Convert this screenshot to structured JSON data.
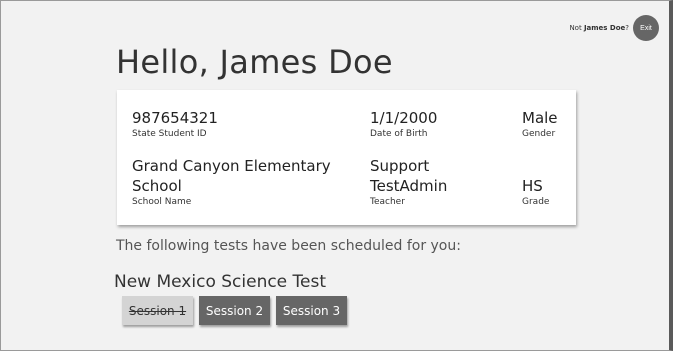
{
  "header": {
    "not_prefix": "Not",
    "user_name": "James Doe",
    "not_suffix": "?",
    "exit_label": "Exit"
  },
  "greeting": "Hello, James Doe",
  "student": {
    "id": {
      "value": "987654321",
      "label": "State Student ID"
    },
    "dob": {
      "value": "1/1/2000",
      "label": "Date of Birth"
    },
    "gender": {
      "value": "Male",
      "label": "Gender"
    },
    "school_line1": "Grand Canyon Elementary",
    "school_line2": "School",
    "school_label": "School Name",
    "teacher_line1": "Support",
    "teacher_line2": "TestAdmin",
    "teacher_label": "Teacher",
    "grade": {
      "value": "HS",
      "label": "Grade"
    }
  },
  "scheduled_text": "The following tests have been scheduled for you:",
  "test": {
    "name": "New Mexico Science Test",
    "sessions": [
      {
        "label": "Session 1",
        "completed": true
      },
      {
        "label": "Session 2",
        "completed": false
      },
      {
        "label": "Session 3",
        "completed": false
      }
    ]
  },
  "colors": {
    "background": "#f2f2f2",
    "card": "#ffffff",
    "button_active": "#666666",
    "button_completed": "#d4d4d4"
  }
}
